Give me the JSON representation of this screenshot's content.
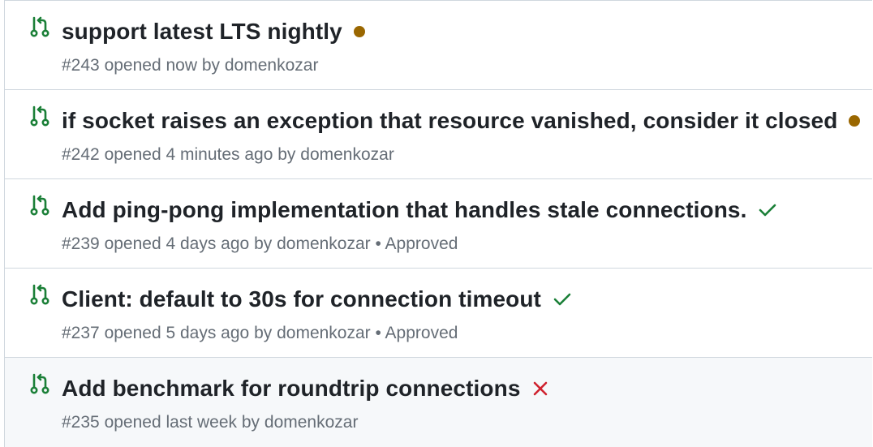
{
  "pull_requests": [
    {
      "title": "support latest LTS nightly",
      "number": "#243",
      "opened": "opened now",
      "by": "by",
      "author": "domenkozar",
      "review": "",
      "status": "pending",
      "status_color": "#9a6700"
    },
    {
      "title": "if socket raises an exception that resource vanished, consider it closed",
      "number": "#242",
      "opened": "opened 4 minutes ago",
      "by": "by",
      "author": "domenkozar",
      "review": "",
      "status": "pending",
      "status_color": "#9a6700"
    },
    {
      "title": "Add ping-pong implementation that handles stale connections.",
      "number": "#239",
      "opened": "opened 4 days ago",
      "by": "by",
      "author": "domenkozar",
      "review_separator": "•",
      "review": "Approved",
      "status": "success",
      "status_color": "#1a7f37"
    },
    {
      "title": "Client: default to 30s for connection timeout",
      "number": "#237",
      "opened": "opened 5 days ago",
      "by": "by",
      "author": "domenkozar",
      "review_separator": "•",
      "review": "Approved",
      "status": "success",
      "status_color": "#1a7f37"
    },
    {
      "title": "Add benchmark for roundtrip connections",
      "number": "#235",
      "opened": "opened last week",
      "by": "by",
      "author": "domenkozar",
      "review": "",
      "status": "failure",
      "status_color": "#cf222e"
    }
  ],
  "icon_names": {
    "pr": "git-pull-request-icon",
    "pending": "pending-dot-icon",
    "success": "check-icon",
    "failure": "x-icon"
  },
  "colors": {
    "pr_open_icon": "#1a7f37",
    "text": "#1f2328",
    "muted": "#656d76",
    "border": "#d0d7de",
    "hover_bg": "#f6f8fa"
  }
}
